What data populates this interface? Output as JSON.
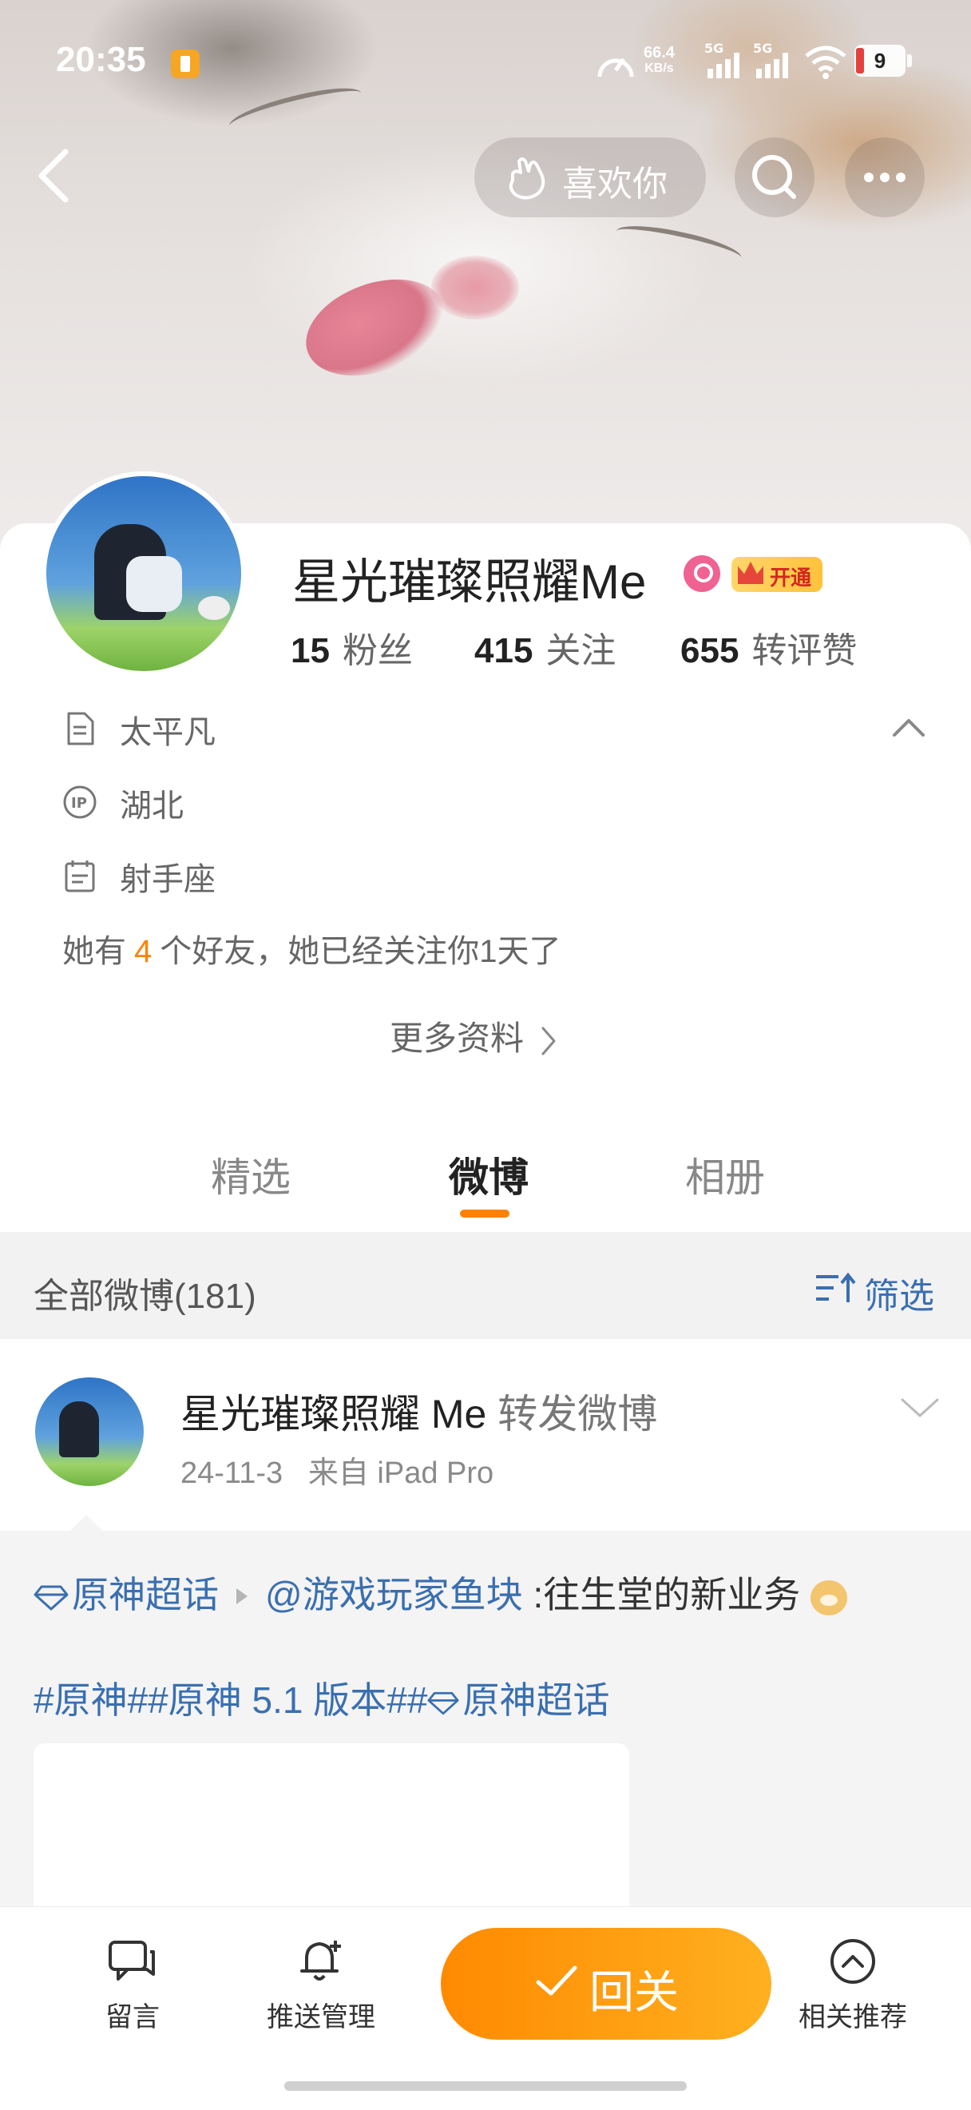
{
  "status_bar": {
    "time": "20:35",
    "net_rate_value": "66.4",
    "net_rate_unit": "KB/s",
    "signal_1": "5G",
    "signal_2": "5G",
    "battery": "9"
  },
  "top_nav": {
    "like_label": "喜欢你"
  },
  "profile": {
    "name": "星光璀璨照耀Me",
    "vip_label": "开通",
    "stats": [
      {
        "value": "15",
        "unit": "粉丝"
      },
      {
        "value": "415",
        "unit": "关注"
      },
      {
        "value": "655",
        "unit": "转评赞"
      }
    ],
    "bio": "太平凡",
    "ip": "湖北",
    "zodiac": "射手座",
    "friends_prefix": "她有",
    "friends_count": "4",
    "friends_suffix": "个好友，她已经关注你1天了",
    "more_info": "更多资料"
  },
  "tabs": [
    {
      "label": "精选",
      "active": false
    },
    {
      "label": "微博",
      "active": true
    },
    {
      "label": "相册",
      "active": false
    }
  ],
  "filter_bar": {
    "all_posts": "全部微博(181)",
    "filter_label": "筛选"
  },
  "post": {
    "author": "星光璀璨照耀 Me",
    "action": "转发微博",
    "date": "24-11-3",
    "source": "来自 iPad Pro",
    "repost": {
      "topic": "原神超话",
      "mention": "@游戏玩家鱼块",
      "text": ":往生堂的新业务",
      "tags_1": "#原神##原神 5.1 版本#",
      "tags_2": "原神超话"
    }
  },
  "bottom_bar": {
    "message": "留言",
    "push": "推送管理",
    "follow_back": "回关",
    "related": "相关推荐"
  },
  "colors": {
    "accent": "#ff8200",
    "link": "#3a6fb0"
  }
}
